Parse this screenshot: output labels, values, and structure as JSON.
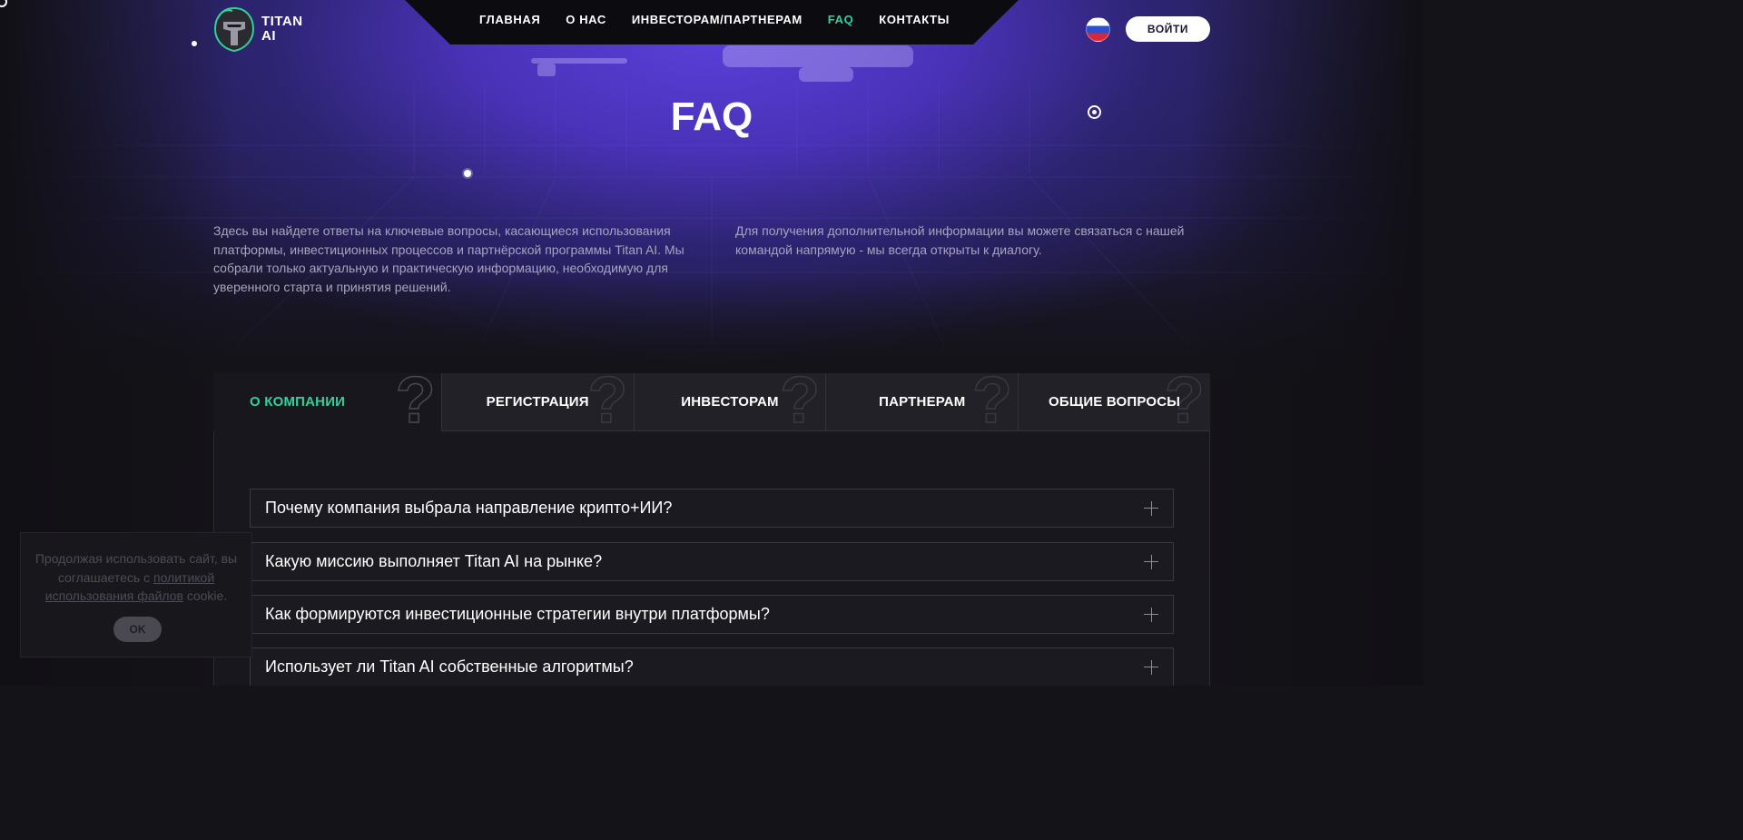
{
  "brand": {
    "name_line1": "TITAN",
    "name_line2": "AI"
  },
  "nav": {
    "items": [
      {
        "label": "ГЛАВНАЯ",
        "active": false
      },
      {
        "label": "О НАС",
        "active": false
      },
      {
        "label": "ИНВЕСТОРАМ/ПАРТНЕРАМ",
        "active": false
      },
      {
        "label": "FAQ",
        "active": true
      },
      {
        "label": "КОНТАКТЫ",
        "active": false
      }
    ],
    "language_icon": "russia-flag-icon",
    "login_label": "ВОЙТИ"
  },
  "hero": {
    "title": "FAQ",
    "intro_left": "Здесь вы найдете ответы на ключевые вопросы, касающиеся использования платформы, инвестиционных процессов и партнёрской программы Titan AI. Мы собрали только актуальную и практическую информацию, необходимую для уверенного старта и принятия решений.",
    "intro_right": "Для получения дополнительной информации вы можете связаться с нашей командой напрямую - мы всегда открыты к диалогу."
  },
  "tabs": [
    {
      "label": "О КОМПАНИИ",
      "active": true
    },
    {
      "label": "РЕГИСТРАЦИЯ",
      "active": false
    },
    {
      "label": "ИНВЕСТОРАМ",
      "active": false
    },
    {
      "label": "ПАРТНЕРАМ",
      "active": false
    },
    {
      "label": "ОБЩИЕ ВОПРОСЫ",
      "active": false
    }
  ],
  "faq": [
    {
      "question": "Почему компания выбрала направление крипто+ИИ?"
    },
    {
      "question": "Какую миссию выполняет Titan AI на рынке?"
    },
    {
      "question": "Как формируются инвестиционные стратегии внутри платформы?"
    },
    {
      "question": "Использует ли Titan AI собственные алгоритмы?"
    }
  ],
  "cookie": {
    "text_before": "Продолжая использовать сайт, вы соглашаетесь с ",
    "link_text": "политикой использования файлов",
    "text_after": " cookie.",
    "ok_label": "OK"
  },
  "colors": {
    "accent": "#2fd39a",
    "hero_purple": "#5b3fd9",
    "background": "#141318"
  }
}
